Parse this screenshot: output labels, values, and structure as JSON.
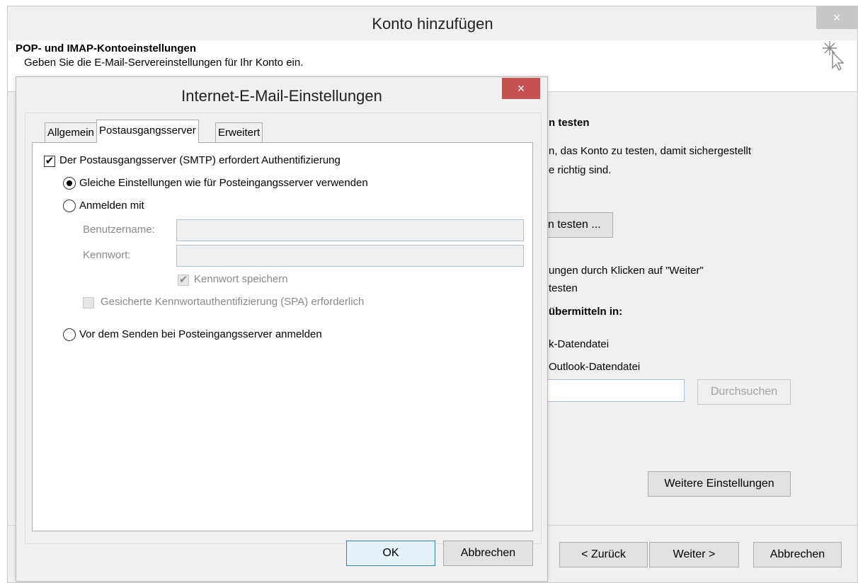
{
  "outer": {
    "title": "Konto hinzufügen",
    "close": "×",
    "header_title": "POP- und IMAP-Kontoeinstellungen",
    "header_subtitle": "Geben Sie die E-Mail-Servereinstellungen für Ihr Konto ein.",
    "test_heading": "n testen",
    "test_desc_1": "n, das Konto zu testen, damit sichergestellt",
    "test_desc_2": "e richtig sind.",
    "test_button": "n testen ...",
    "auto_test_1": "ungen durch Klicken auf \"Weiter\"",
    "auto_test_2": "testen",
    "deliver_heading": "übermitteln in:",
    "opt_new": "k-Datendatei",
    "opt_existing": "Outlook-Datendatei",
    "browse": "Durchsuchen",
    "more_settings": "Weitere Einstellungen",
    "back": "< Zurück",
    "next": "Weiter >",
    "cancel": "Abbrechen"
  },
  "dialog": {
    "title": "Internet-E-Mail-Einstellungen",
    "close": "×",
    "tabs": [
      "Allgemein",
      "Postausgangsserver",
      "Erweitert"
    ],
    "smtp_auth_label": "Der Postausgangsserver (SMTP) erfordert Authentifizierung",
    "same_settings_label": "Gleiche Einstellungen wie für Posteingangsserver verwenden",
    "login_with_label": "Anmelden mit",
    "username_label": "Benutzername:",
    "password_label": "Kennwort:",
    "username_value": "",
    "password_value": "",
    "save_password_label": "Kennwort speichern",
    "spa_label": "Gesicherte Kennwortauthentifizierung (SPA) erforderlich",
    "login_before_label": "Vor dem Senden bei Posteingangsserver anmelden",
    "ok": "OK",
    "cancel": "Abbrechen"
  }
}
